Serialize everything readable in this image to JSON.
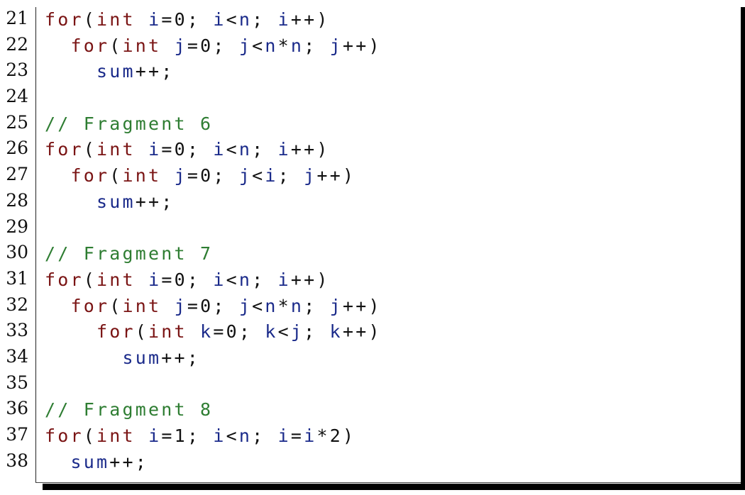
{
  "colors": {
    "keyword": "#7a1414",
    "identifier": "#1a2a8a",
    "comment": "#2e7d32",
    "punct": "#111111"
  },
  "lines": [
    {
      "num": "21",
      "tokens": [
        [
          "kw",
          "for"
        ],
        [
          "p",
          "("
        ],
        [
          "kw",
          "int"
        ],
        [
          "p",
          " "
        ],
        [
          "id",
          "i"
        ],
        [
          "p",
          "=0; "
        ],
        [
          "id",
          "i"
        ],
        [
          "p",
          "<"
        ],
        [
          "id",
          "n"
        ],
        [
          "p",
          "; "
        ],
        [
          "id",
          "i"
        ],
        [
          "p",
          "++)"
        ]
      ]
    },
    {
      "num": "22",
      "tokens": [
        [
          "p",
          "  "
        ],
        [
          "kw",
          "for"
        ],
        [
          "p",
          "("
        ],
        [
          "kw",
          "int"
        ],
        [
          "p",
          " "
        ],
        [
          "id",
          "j"
        ],
        [
          "p",
          "=0; "
        ],
        [
          "id",
          "j"
        ],
        [
          "p",
          "<"
        ],
        [
          "id",
          "n"
        ],
        [
          "p",
          "*"
        ],
        [
          "id",
          "n"
        ],
        [
          "p",
          "; "
        ],
        [
          "id",
          "j"
        ],
        [
          "p",
          "++)"
        ]
      ]
    },
    {
      "num": "23",
      "tokens": [
        [
          "p",
          "    "
        ],
        [
          "id",
          "sum"
        ],
        [
          "p",
          "++;"
        ]
      ]
    },
    {
      "num": "24",
      "tokens": []
    },
    {
      "num": "25",
      "tokens": [
        [
          "cm",
          "// Fragment 6"
        ]
      ]
    },
    {
      "num": "26",
      "tokens": [
        [
          "kw",
          "for"
        ],
        [
          "p",
          "("
        ],
        [
          "kw",
          "int"
        ],
        [
          "p",
          " "
        ],
        [
          "id",
          "i"
        ],
        [
          "p",
          "=0; "
        ],
        [
          "id",
          "i"
        ],
        [
          "p",
          "<"
        ],
        [
          "id",
          "n"
        ],
        [
          "p",
          "; "
        ],
        [
          "id",
          "i"
        ],
        [
          "p",
          "++)"
        ]
      ]
    },
    {
      "num": "27",
      "tokens": [
        [
          "p",
          "  "
        ],
        [
          "kw",
          "for"
        ],
        [
          "p",
          "("
        ],
        [
          "kw",
          "int"
        ],
        [
          "p",
          " "
        ],
        [
          "id",
          "j"
        ],
        [
          "p",
          "=0; "
        ],
        [
          "id",
          "j"
        ],
        [
          "p",
          "<"
        ],
        [
          "id",
          "i"
        ],
        [
          "p",
          "; "
        ],
        [
          "id",
          "j"
        ],
        [
          "p",
          "++)"
        ]
      ]
    },
    {
      "num": "28",
      "tokens": [
        [
          "p",
          "    "
        ],
        [
          "id",
          "sum"
        ],
        [
          "p",
          "++;"
        ]
      ]
    },
    {
      "num": "29",
      "tokens": []
    },
    {
      "num": "30",
      "tokens": [
        [
          "cm",
          "// Fragment 7"
        ]
      ]
    },
    {
      "num": "31",
      "tokens": [
        [
          "kw",
          "for"
        ],
        [
          "p",
          "("
        ],
        [
          "kw",
          "int"
        ],
        [
          "p",
          " "
        ],
        [
          "id",
          "i"
        ],
        [
          "p",
          "=0; "
        ],
        [
          "id",
          "i"
        ],
        [
          "p",
          "<"
        ],
        [
          "id",
          "n"
        ],
        [
          "p",
          "; "
        ],
        [
          "id",
          "i"
        ],
        [
          "p",
          "++)"
        ]
      ]
    },
    {
      "num": "32",
      "tokens": [
        [
          "p",
          "  "
        ],
        [
          "kw",
          "for"
        ],
        [
          "p",
          "("
        ],
        [
          "kw",
          "int"
        ],
        [
          "p",
          " "
        ],
        [
          "id",
          "j"
        ],
        [
          "p",
          "=0; "
        ],
        [
          "id",
          "j"
        ],
        [
          "p",
          "<"
        ],
        [
          "id",
          "n"
        ],
        [
          "p",
          "*"
        ],
        [
          "id",
          "n"
        ],
        [
          "p",
          "; "
        ],
        [
          "id",
          "j"
        ],
        [
          "p",
          "++)"
        ]
      ]
    },
    {
      "num": "33",
      "tokens": [
        [
          "p",
          "    "
        ],
        [
          "kw",
          "for"
        ],
        [
          "p",
          "("
        ],
        [
          "kw",
          "int"
        ],
        [
          "p",
          " "
        ],
        [
          "id",
          "k"
        ],
        [
          "p",
          "=0; "
        ],
        [
          "id",
          "k"
        ],
        [
          "p",
          "<"
        ],
        [
          "id",
          "j"
        ],
        [
          "p",
          "; "
        ],
        [
          "id",
          "k"
        ],
        [
          "p",
          "++)"
        ]
      ]
    },
    {
      "num": "34",
      "tokens": [
        [
          "p",
          "      "
        ],
        [
          "id",
          "sum"
        ],
        [
          "p",
          "++;"
        ]
      ]
    },
    {
      "num": "35",
      "tokens": []
    },
    {
      "num": "36",
      "tokens": [
        [
          "cm",
          "// Fragment 8"
        ]
      ]
    },
    {
      "num": "37",
      "tokens": [
        [
          "kw",
          "for"
        ],
        [
          "p",
          "("
        ],
        [
          "kw",
          "int"
        ],
        [
          "p",
          " "
        ],
        [
          "id",
          "i"
        ],
        [
          "p",
          "=1; "
        ],
        [
          "id",
          "i"
        ],
        [
          "p",
          "<"
        ],
        [
          "id",
          "n"
        ],
        [
          "p",
          "; "
        ],
        [
          "id",
          "i"
        ],
        [
          "p",
          "="
        ],
        [
          "id",
          "i"
        ],
        [
          "p",
          "*2)"
        ]
      ]
    },
    {
      "num": "38",
      "tokens": [
        [
          "p",
          "  "
        ],
        [
          "id",
          "sum"
        ],
        [
          "p",
          "++;"
        ]
      ]
    }
  ]
}
